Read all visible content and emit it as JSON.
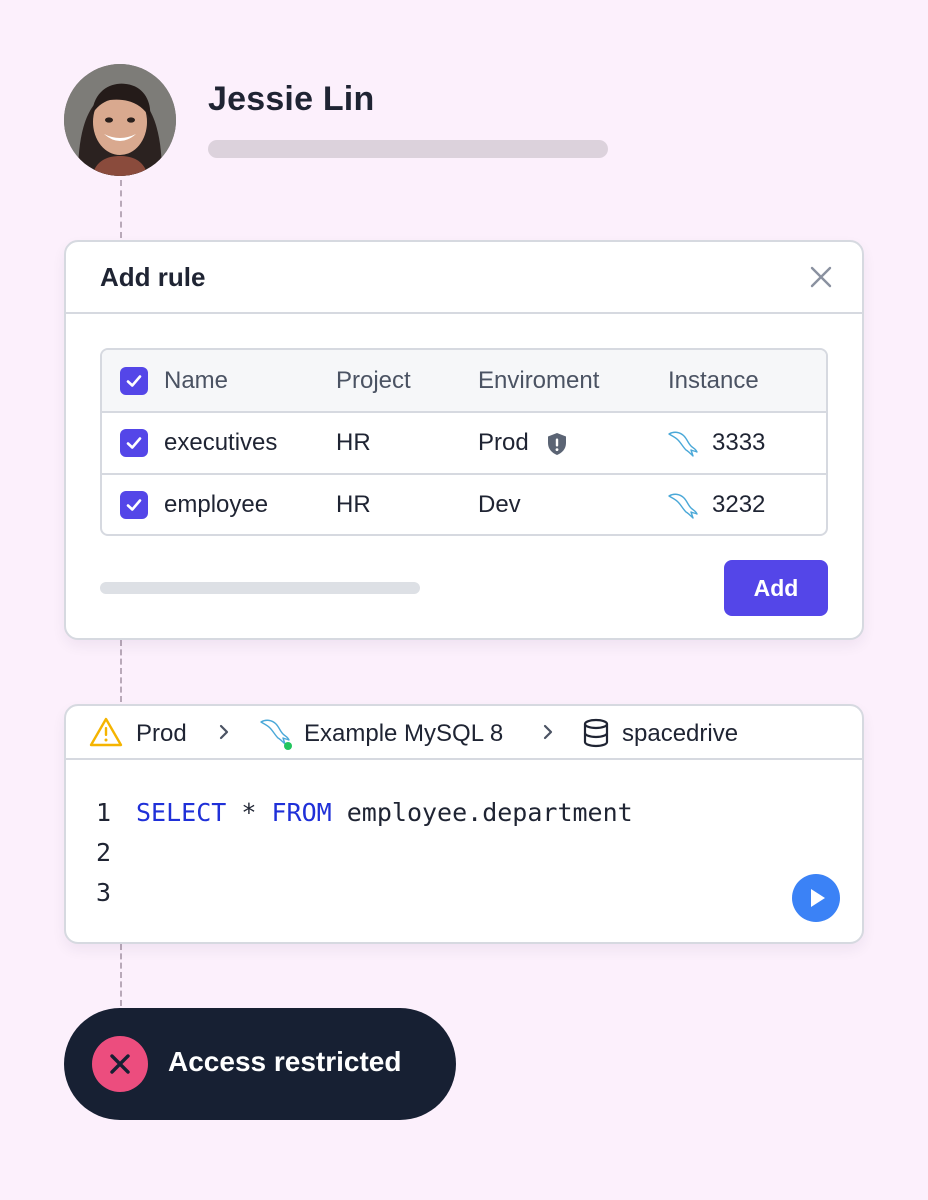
{
  "user": {
    "name": "Jessie Lin"
  },
  "dialog": {
    "title": "Add rule",
    "columns": [
      "Name",
      "Project",
      "Enviroment",
      "Instance"
    ],
    "rows": [
      {
        "name": "executives",
        "project": "HR",
        "environment": "Prod",
        "instance": "3333",
        "checked": true,
        "protected": true
      },
      {
        "name": "employee",
        "project": "HR",
        "environment": "Dev",
        "instance": "3232",
        "checked": true,
        "protected": false
      }
    ],
    "add_label": "Add"
  },
  "editor": {
    "breadcrumb": {
      "environment": "Prod",
      "instance": "Example MySQL 8",
      "database": "spacedrive"
    },
    "lines": [
      {
        "number": "1",
        "keyword1": "SELECT",
        "middle": " * ",
        "keyword2": "FROM",
        "rest": " employee.department"
      },
      {
        "number": "2"
      },
      {
        "number": "3"
      }
    ]
  },
  "toast": {
    "message": "Access restricted"
  },
  "colors": {
    "background": "#fcf0fc",
    "accent": "#5446e8",
    "run": "#3b82f6",
    "toast_bg": "#172033",
    "error": "#ec4d7e",
    "warning": "#f5b400",
    "sql_keyword": "#1f30d8"
  }
}
